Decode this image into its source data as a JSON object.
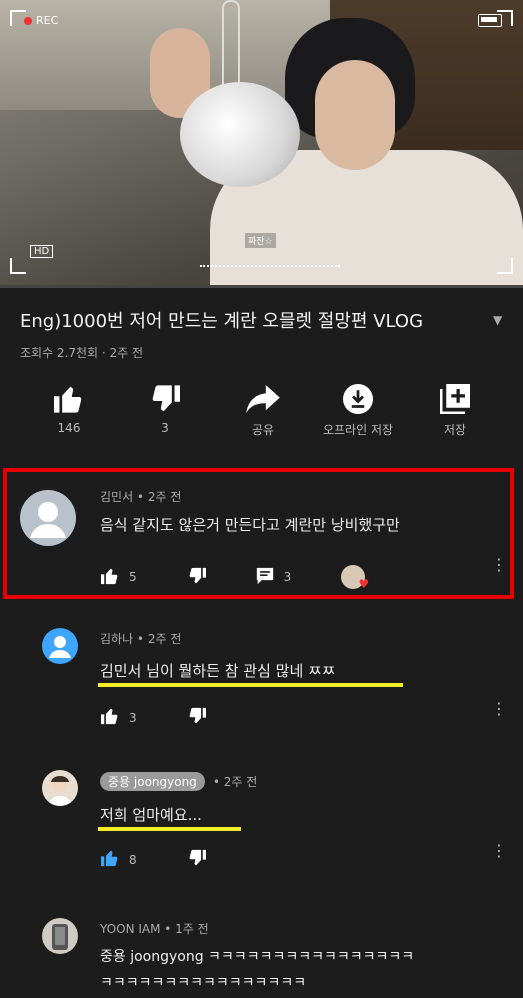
{
  "video": {
    "rec_label": "REC",
    "hd_label": "HD",
    "caption": "짜잔☆"
  },
  "info": {
    "title": "Eng)1000번 저어 만드는 계란 오믈렛 절망편 VLOG",
    "meta": "조회수 2.7천회 · 2주 전"
  },
  "actions": [
    {
      "icon": "thumbs-up-icon",
      "label": "146"
    },
    {
      "icon": "thumbs-down-icon",
      "label": "3"
    },
    {
      "icon": "share-icon",
      "label": "공유"
    },
    {
      "icon": "download-icon",
      "label": "오프라인 저장"
    },
    {
      "icon": "add-to-playlist-icon",
      "label": "저장"
    }
  ],
  "comments": [
    {
      "author": "김민서 • 2주 전",
      "text": "음식 같지도 않은거 만든다고 계란만 낭비했구만",
      "likes": "5",
      "replies": "3"
    },
    {
      "author": "김하나 • 2주 전",
      "text": "김민서 님이 뭘하든 참 관심 많네 ㅉㅉ",
      "likes": "3"
    },
    {
      "author_chip": "중용 joongyong",
      "time": "• 2주 전",
      "text": "저희 엄마예요...",
      "likes": "8"
    },
    {
      "author": "YOON IAM • 1주 전",
      "text": "중용 joongyong ㅋㅋㅋㅋㅋㅋㅋㅋㅋㅋㅋㅋㅋㅋㅋㅋ",
      "text2": "ㅋㅋㅋㅋㅋㅋㅋㅋㅋㅋㅋㅋㅋㅋㅋㅋ"
    }
  ],
  "colors": {
    "highlight": "#e60000",
    "underline": "#f5ef2a",
    "like_active": "#3ea6ff"
  }
}
